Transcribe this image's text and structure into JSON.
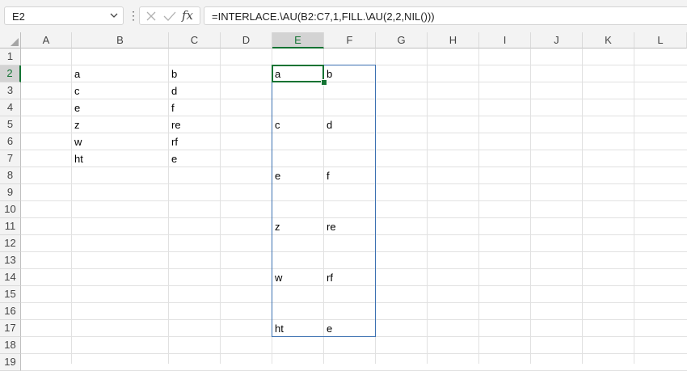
{
  "name_box": {
    "value": "E2"
  },
  "formula_bar": {
    "fx_label": "fx",
    "formula": "=INTERLACE.\\AU(B2:C7,1,FILL.\\AU(2,2,NIL()))"
  },
  "columns": [
    "A",
    "B",
    "C",
    "D",
    "E",
    "F",
    "G",
    "H",
    "I",
    "J",
    "K",
    "L"
  ],
  "selected_column": "E",
  "rows": [
    "1",
    "2",
    "3",
    "4",
    "5",
    "6",
    "7",
    "8",
    "9",
    "10",
    "11",
    "12",
    "13",
    "14",
    "15",
    "16",
    "17",
    "18",
    "19"
  ],
  "selected_row": "2",
  "cells": [
    {
      "ref": "B2",
      "value": "a"
    },
    {
      "ref": "C2",
      "value": "b"
    },
    {
      "ref": "B3",
      "value": "c"
    },
    {
      "ref": "C3",
      "value": "d"
    },
    {
      "ref": "B4",
      "value": "e"
    },
    {
      "ref": "C4",
      "value": "f"
    },
    {
      "ref": "B5",
      "value": "z"
    },
    {
      "ref": "C5",
      "value": "re"
    },
    {
      "ref": "B6",
      "value": "w"
    },
    {
      "ref": "C6",
      "value": "rf"
    },
    {
      "ref": "B7",
      "value": "ht"
    },
    {
      "ref": "C7",
      "value": "e"
    },
    {
      "ref": "E2",
      "value": "a"
    },
    {
      "ref": "F2",
      "value": "b"
    },
    {
      "ref": "E5",
      "value": "c"
    },
    {
      "ref": "F5",
      "value": "d"
    },
    {
      "ref": "E8",
      "value": "e"
    },
    {
      "ref": "F8",
      "value": "f"
    },
    {
      "ref": "E11",
      "value": "z"
    },
    {
      "ref": "F11",
      "value": "re"
    },
    {
      "ref": "E14",
      "value": "w"
    },
    {
      "ref": "F14",
      "value": "rf"
    },
    {
      "ref": "E17",
      "value": "ht"
    },
    {
      "ref": "F17",
      "value": "e"
    }
  ],
  "active_cell": "E2",
  "spill_range": "E2:F17",
  "colors": {
    "accent_green": "#137333",
    "spill_border": "#3a6fb0"
  }
}
